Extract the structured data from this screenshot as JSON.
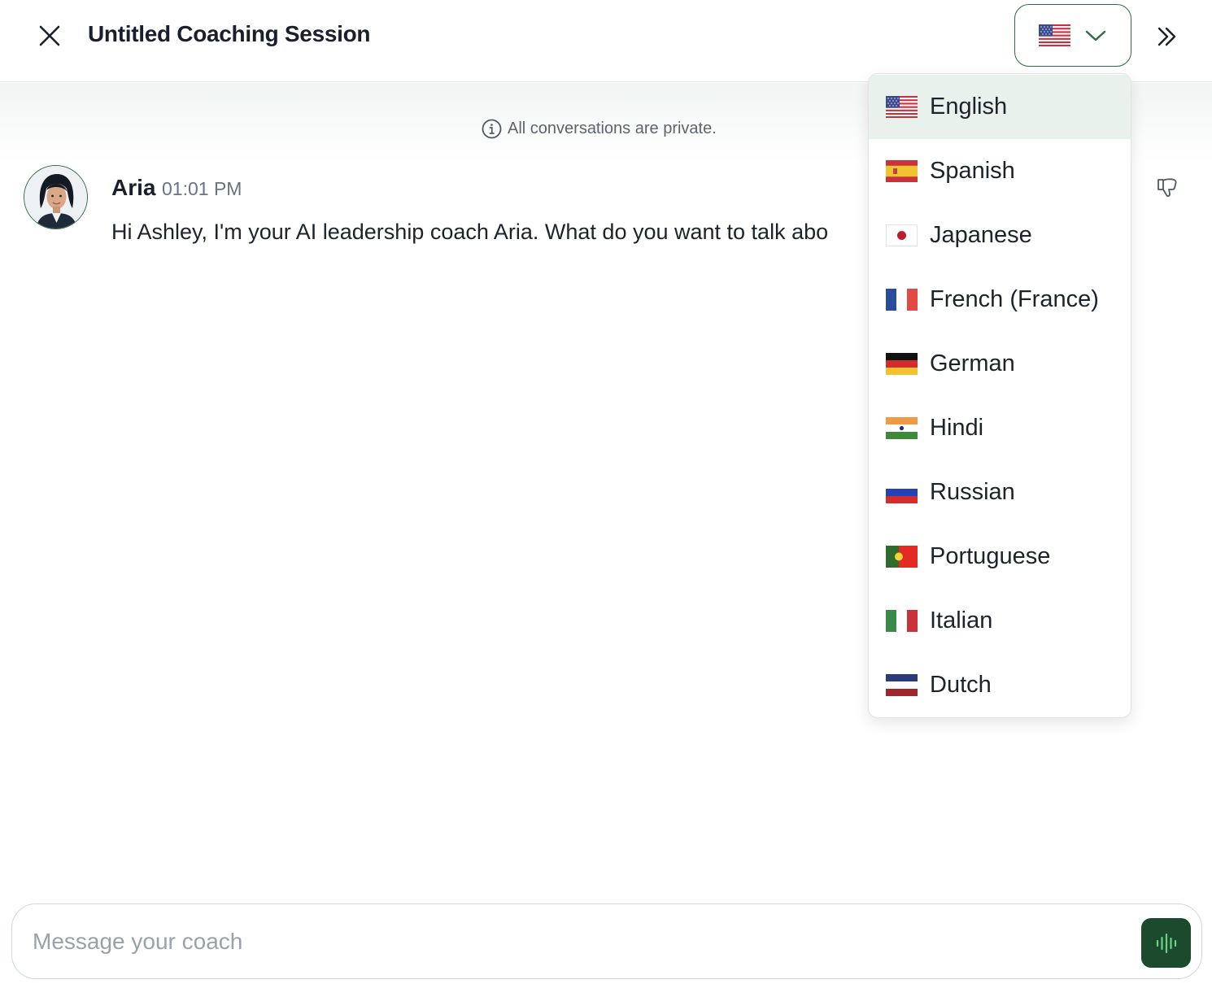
{
  "header": {
    "title": "Untitled Coaching Session",
    "close_icon": "close-icon",
    "expand_icon": "double-chevron-right-icon",
    "language_selector": {
      "selected": "English",
      "flag": "us"
    }
  },
  "privacy_notice": {
    "icon": "info-icon",
    "text": "All conversations are private."
  },
  "messages": [
    {
      "sender": "Aria",
      "time": "01:01 PM",
      "text": "Hi Ashley, I'm your AI leadership coach Aria. What do you want to talk abo",
      "feedback_icon": "thumbs-down-icon"
    }
  ],
  "language_dropdown": {
    "options": [
      {
        "label": "English",
        "flag": "us",
        "selected": true
      },
      {
        "label": "Spanish",
        "flag": "es",
        "selected": false
      },
      {
        "label": "Japanese",
        "flag": "jp",
        "selected": false
      },
      {
        "label": "French (France)",
        "flag": "fr",
        "selected": false
      },
      {
        "label": "German",
        "flag": "de",
        "selected": false
      },
      {
        "label": "Hindi",
        "flag": "in",
        "selected": false
      },
      {
        "label": "Russian",
        "flag": "ru",
        "selected": false
      },
      {
        "label": "Portuguese",
        "flag": "pt",
        "selected": false
      },
      {
        "label": "Italian",
        "flag": "it",
        "selected": false
      },
      {
        "label": "Dutch",
        "flag": "nl",
        "selected": false
      }
    ]
  },
  "composer": {
    "placeholder": "Message your coach",
    "value": "",
    "voice_icon": "audio-waveform-icon"
  },
  "colors": {
    "accent": "#2f6b45",
    "voice_button": "#1b4a2d",
    "selected_option_bg": "#e9f1ed"
  }
}
